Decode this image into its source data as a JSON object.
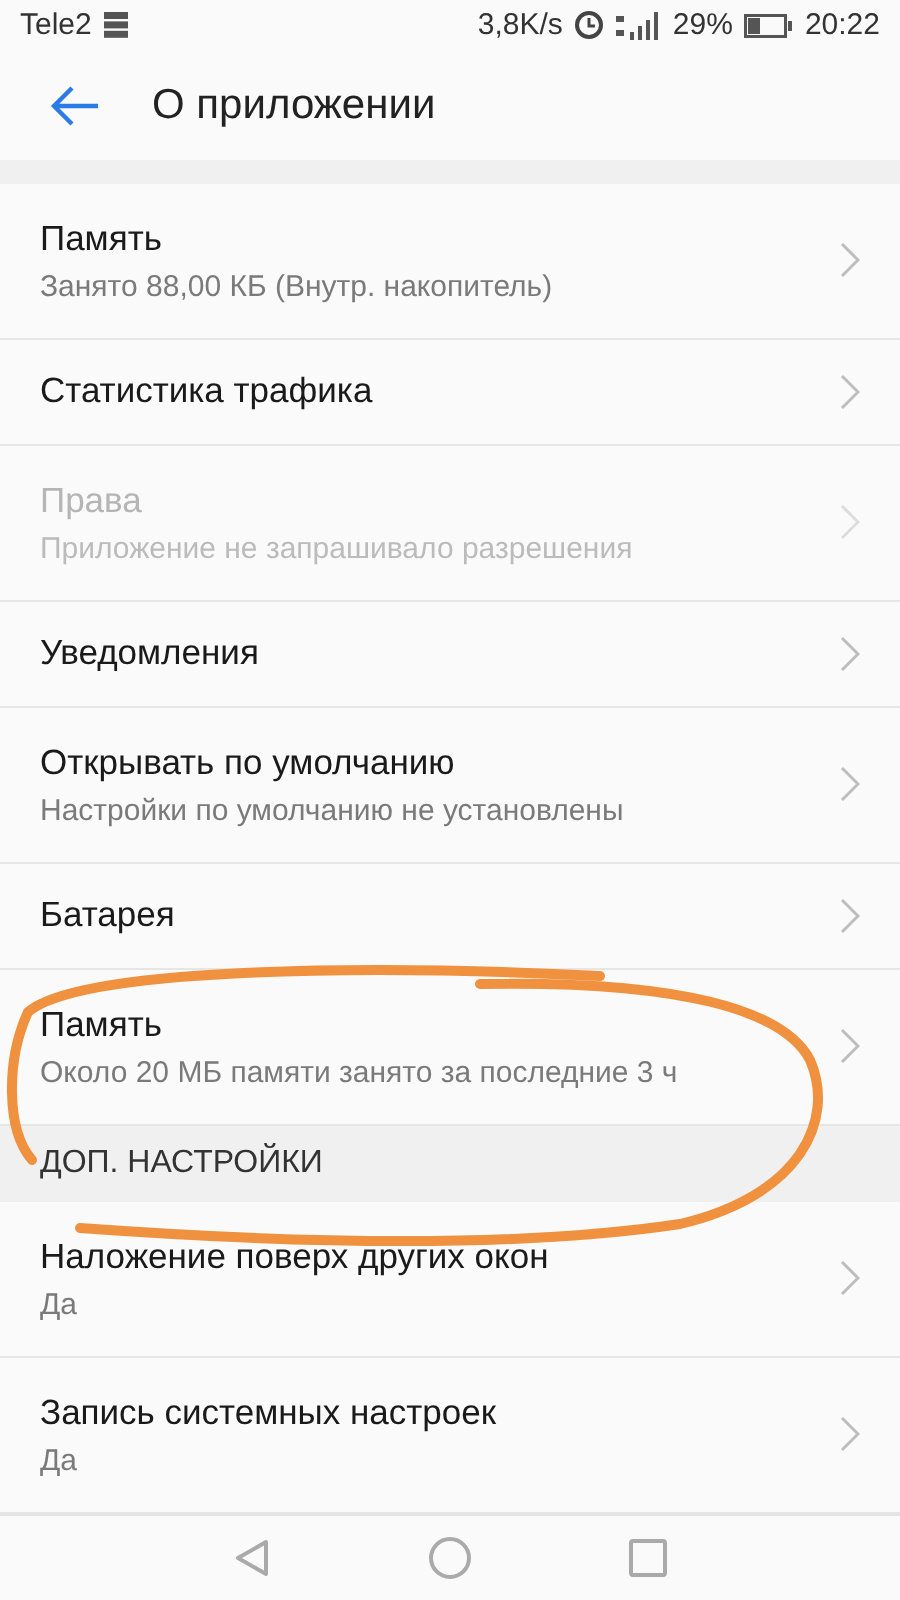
{
  "status_bar": {
    "carrier": "Tele2",
    "speed": "3,8K/s",
    "battery": "29%",
    "time": "20:22"
  },
  "header": {
    "title": "О приложении"
  },
  "items": [
    {
      "kind": "item",
      "title": "Память",
      "subtitle": "Занято 88,00 КБ (Внутр. накопитель)",
      "disabled": false
    },
    {
      "kind": "item",
      "title": "Статистика трафика",
      "disabled": false
    },
    {
      "kind": "item",
      "title": "Права",
      "subtitle": "Приложение не запрашивало разрешения",
      "disabled": true
    },
    {
      "kind": "item",
      "title": "Уведомления",
      "disabled": false
    },
    {
      "kind": "item",
      "title": "Открывать по умолчанию",
      "subtitle": "Настройки по умолчанию не установлены",
      "disabled": false
    },
    {
      "kind": "item",
      "title": "Батарея",
      "disabled": false
    },
    {
      "kind": "item",
      "title": "Память",
      "subtitle": "Около 20 МБ памяти занято за последние 3 ч",
      "disabled": false
    },
    {
      "kind": "section",
      "title": "ДОП. НАСТРОЙКИ"
    },
    {
      "kind": "item",
      "title": "Наложение поверх других окон",
      "subtitle": "Да",
      "disabled": false
    },
    {
      "kind": "item",
      "title": "Запись системных настроек",
      "subtitle": "Да",
      "disabled": false
    }
  ]
}
